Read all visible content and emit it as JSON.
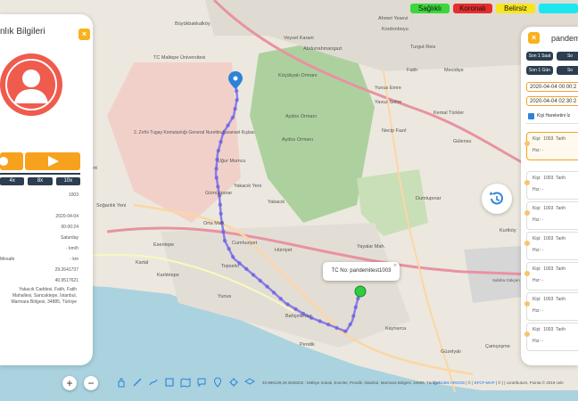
{
  "legend": [
    {
      "label": "Sağlıklı",
      "color": "#3cd63c"
    },
    {
      "label": "Koronalı",
      "color": "#e62e2e"
    },
    {
      "label": "Belirsiz",
      "color": "#f7e51e"
    },
    {
      "label": "",
      "color": "#1ee6f0"
    }
  ],
  "left_panel": {
    "title": "nlık Bilgileri",
    "close_label": "×",
    "speed_options": [
      "4x",
      "8x",
      "10x"
    ],
    "info": [
      {
        "label": "",
        "value": "1003"
      },
      {
        "label": "",
        "value": ""
      },
      {
        "label": "",
        "value": "2020-04-04"
      },
      {
        "label": "",
        "value": "00:00:24"
      },
      {
        "label": "",
        "value": "Saturday"
      },
      {
        "label": "",
        "value": "- km/h"
      },
      {
        "label": "Mesafe",
        "value": "- km"
      },
      {
        "label": "",
        "value": "29.2641737"
      },
      {
        "label": "",
        "value": "40.9517621"
      }
    ],
    "address": "Yakacık Caddesi, Fatih, Fatih Mahallesi, Sancaktepe, İstanbul, Marmara Bölgesi, 34885, Türkiye"
  },
  "right_panel": {
    "title": "pandem",
    "close_label": "×",
    "filters": [
      "Son 1 Saat",
      "So",
      "Son 1 Gün",
      "So"
    ],
    "date_from": "2020-04-04 00:00:2",
    "date_to": "2020-04-04 02:30:2",
    "checkbox_label": "Kişi Hareketini İz",
    "cards": [
      {
        "kisi": "Kişi:",
        "id": "1003",
        "tarih": "Tarih",
        "hiz": "Hız: -"
      },
      {
        "kisi": "Kişi:",
        "id": "1003",
        "tarih": "Tarih",
        "hiz": "Hız: -"
      },
      {
        "kisi": "Kişi:",
        "id": "1003",
        "tarih": "Tarih",
        "hiz": "Hız: -"
      },
      {
        "kisi": "Kişi:",
        "id": "1003",
        "tarih": "Tarih",
        "hiz": "Hız: -"
      },
      {
        "kisi": "Kişi:",
        "id": "1003",
        "tarih": "Tarih",
        "hiz": "Hız: -"
      },
      {
        "kisi": "Kişi:",
        "id": "1003",
        "tarih": "Tarih",
        "hiz": "Hız: -"
      },
      {
        "kisi": "Kişi:",
        "id": "1003",
        "tarih": "Tarih",
        "hiz": "Hız: -"
      }
    ]
  },
  "popup": {
    "text": "TC No: pandemitest1003",
    "close": "×"
  },
  "map": {
    "labels": [
      "Büyükbakkalköy",
      "Veysel Karani",
      "Ahmet Yesevi",
      "Kordonboyu",
      "Abdurrahmangazi",
      "Turgut Reis",
      "TC Maltepe Üniversitesi",
      "Fatih",
      "Mecidiye",
      "Küçükyalı Ormanı",
      "Yunus Emre",
      "Yavuz Selim",
      "Kemal Türkler",
      "Aydos Ormanı",
      "Necip Fazıl",
      "Gülensu",
      "2. Zırhlı Tugay Komutanlığı General Nurettin Baransel Kışlası",
      "Esenkent",
      "Aydos Ormanı",
      "Soğanlık Yeni",
      "Yakacık Yeni",
      "Gümüşpınar",
      "Yakacık",
      "Orta Mah.",
      "Cumhuriyet",
      "Hürriyet",
      "Yayalar Mah.",
      "Esentepe",
      "Topselvi",
      "Kartal",
      "Karlıktepe",
      "Yunus",
      "Kaynarca",
      "Bahçelievler",
      "Pendik",
      "Kurtköy",
      "Sabiha Gökçen Havalimanı",
      "Güzelyalı",
      "Çamçeşme",
      "Dumlupınar",
      "Uğur Mumcu"
    ],
    "zoom_in": "+",
    "zoom_out": "−",
    "coords_text": "40.899128,29.2848202 : Mükiye Sokak, Esenler, Pendik, İstanbul, Marmara Bölgesi, 34899, Türkiye",
    "attribution_link": "Çekirdek ARGOS",
    "attribution_link2": "EFCF-MAP",
    "attribution_rest": "| © |  | contributors, Pointa © 2019 ceki"
  }
}
